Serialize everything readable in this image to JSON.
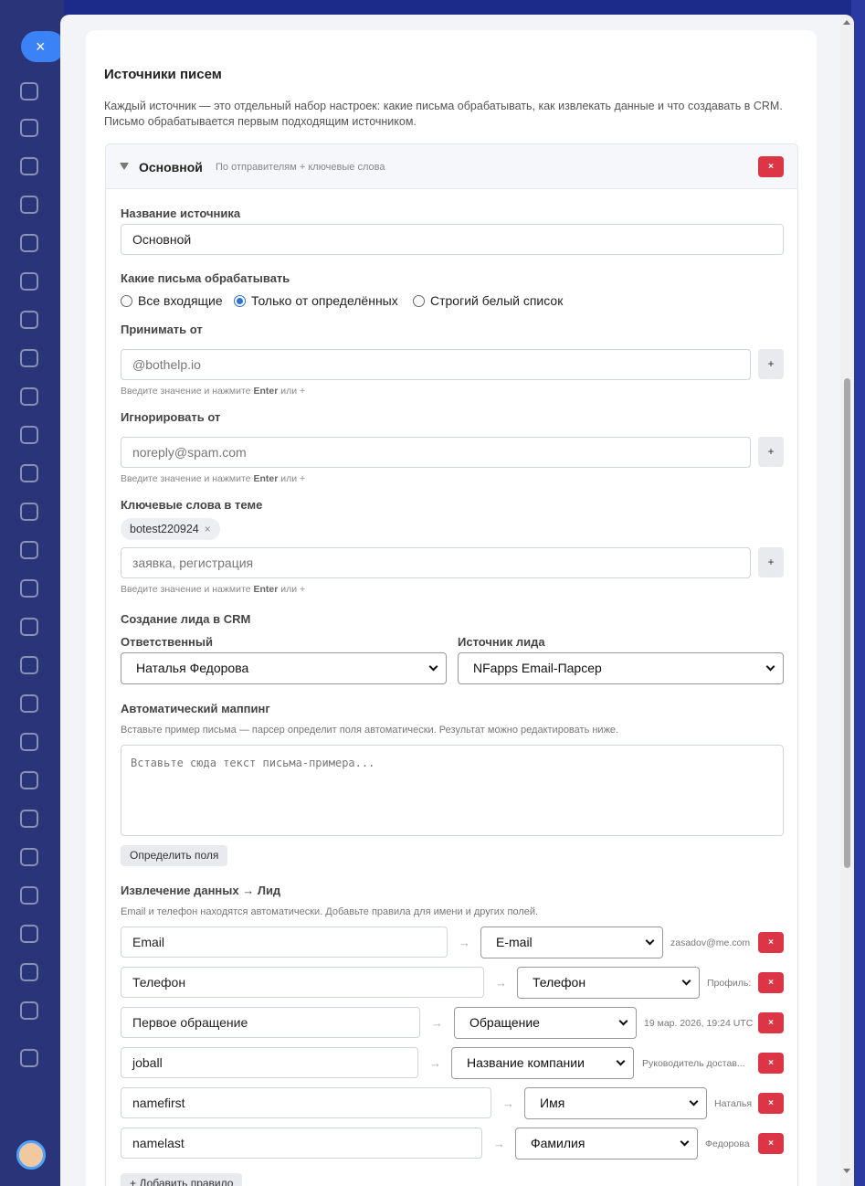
{
  "background": {
    "close_glyph": "×"
  },
  "modal": {
    "title": "Источники писем",
    "description": "Каждый источник — это отдельный набор настроек: какие письма обрабатывать, как извлекать данные и что создавать в CRM. Письмо обрабатывается первым подходящим источником.",
    "source": {
      "name": "Основной",
      "mode": "По отправителям + ключевые слова",
      "delete_glyph": "×",
      "name_label": "Название источника",
      "name_value": "Основной",
      "filter_label": "Какие письма обрабатывать",
      "filter_options": [
        "Все входящие",
        "Только от определённых",
        "Строгий белый список"
      ],
      "filter_selected": 1,
      "accept_from": {
        "label": "Принимать от",
        "placeholder": "@bothelp.io"
      },
      "ignore_from": {
        "label": "Игнорировать от",
        "placeholder": "noreply@spam.com"
      },
      "keywords": {
        "label": "Ключевые слова в теме",
        "chips": [
          "botest220924"
        ],
        "placeholder": "заявка, регистрация"
      },
      "hint": {
        "prefix": "Введите значение и нажмите",
        "key": "Enter",
        "suffix": "или +"
      },
      "plus_glyph": "+",
      "lead_section_title": "Создание лида в CRM",
      "responsible": {
        "label": "Ответственный",
        "value": "Наталья Федорова"
      },
      "lead_source": {
        "label": "Источник лида",
        "value": "NFapps Email-Парсер"
      },
      "automap": {
        "title": "Автоматический маппинг",
        "description": "Вставьте пример письма — парсер определит поля автоматически. Результат можно редактировать ниже.",
        "placeholder": "Вставьте сюда текст письма-примера...",
        "button": "Определить поля"
      },
      "extraction": {
        "title": "Извлечение данных → Лид",
        "description": "Email и телефон находятся автоматически. Добавьте правила для имени и других полей.",
        "arrow": "→",
        "rules": [
          {
            "field": "Email",
            "target": "E-mail",
            "sample": "zasadov@me.com"
          },
          {
            "field": "Телефон",
            "target": "Телефон",
            "sample": "Профиль:"
          },
          {
            "field": "Первое обращение",
            "target": "Обращение",
            "sample": "19 мар. 2026, 19:24 UTC"
          },
          {
            "field": "joball",
            "target": "Название компании",
            "sample": "Руководитель достав..."
          },
          {
            "field": "namefirst",
            "target": "Имя",
            "sample": "Наталья"
          },
          {
            "field": "namelast",
            "target": "Фамилия",
            "sample": "Федорова"
          }
        ],
        "add_button": "+ Добавить правило"
      }
    }
  }
}
